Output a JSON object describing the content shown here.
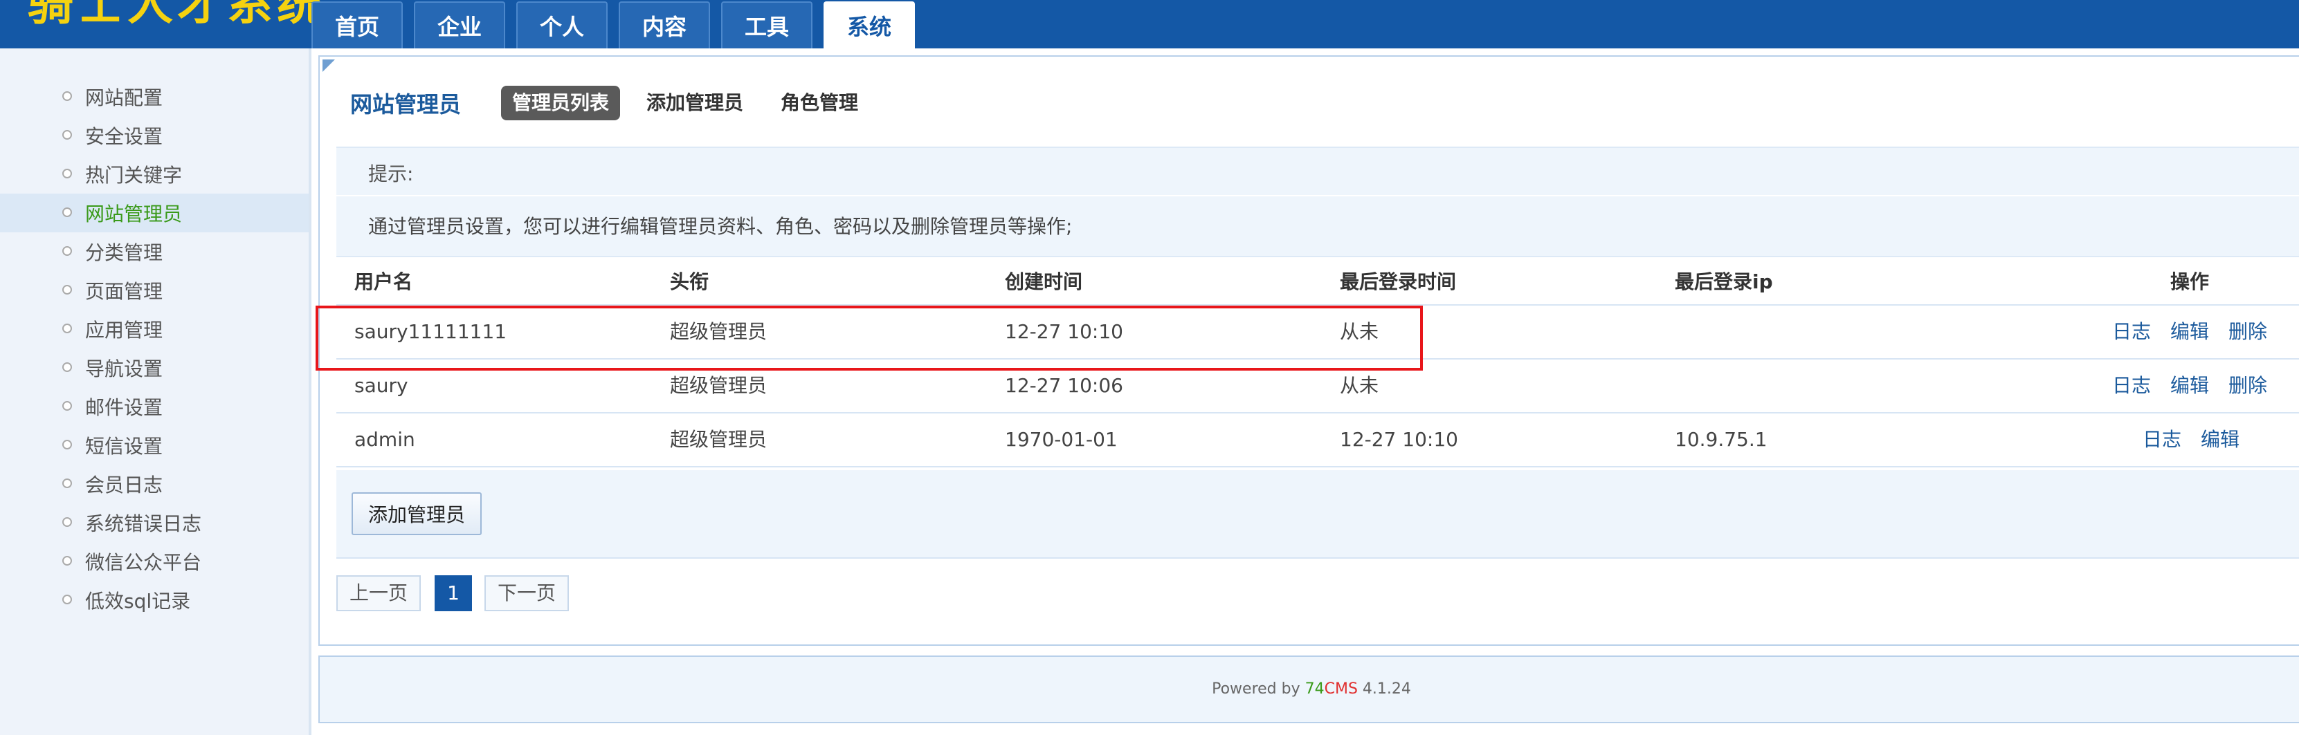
{
  "header": {
    "logo_text": "骑士人才系统",
    "nav": [
      "首页",
      "企业",
      "个人",
      "内容",
      "工具",
      "系统"
    ],
    "active_nav": "系统"
  },
  "sidebar": {
    "items": [
      {
        "label": "网站配置"
      },
      {
        "label": "安全设置"
      },
      {
        "label": "热门关键字"
      },
      {
        "label": "网站管理员",
        "active": true
      },
      {
        "label": "分类管理"
      },
      {
        "label": "页面管理"
      },
      {
        "label": "应用管理"
      },
      {
        "label": "导航设置"
      },
      {
        "label": "邮件设置"
      },
      {
        "label": "短信设置"
      },
      {
        "label": "会员日志"
      },
      {
        "label": "系统错误日志"
      },
      {
        "label": "微信公众平台"
      },
      {
        "label": "低效sql记录"
      }
    ]
  },
  "main": {
    "title": "网站管理员",
    "subtabs": [
      "管理员列表",
      "添加管理员",
      "角色管理"
    ],
    "tip_title": "提示:",
    "tip_text": "通过管理员设置，您可以进行编辑管理员资料、角色、密码以及删除管理员等操作;",
    "table": {
      "headers": [
        "用户名",
        "头衔",
        "创建时间",
        "最后登录时间",
        "最后登录ip",
        "操作"
      ],
      "rows": [
        {
          "username": "saury11111111",
          "title": "超级管理员",
          "created": "12-27 10:10",
          "last_login": "从未",
          "last_ip": "",
          "actions": [
            "日志",
            "编辑",
            "删除"
          ]
        },
        {
          "username": "saury",
          "title": "超级管理员",
          "created": "12-27 10:06",
          "last_login": "从未",
          "last_ip": "",
          "actions": [
            "日志",
            "编辑",
            "删除"
          ]
        },
        {
          "username": "admin",
          "title": "超级管理员",
          "created": "1970-01-01",
          "last_login": "12-27 10:10",
          "last_ip": "10.9.75.1",
          "actions": [
            "日志",
            "编辑"
          ]
        }
      ]
    },
    "add_button": "添加管理员",
    "pagination": {
      "prev": "上一页",
      "current": "1",
      "next": "下一页"
    }
  },
  "footer": {
    "powered_prefix": "Powered by ",
    "brand_num": "74",
    "brand_name": "CMS",
    "version": " 4.1.24"
  },
  "colors": {
    "header_bg": "#1458a6",
    "highlight": "#e8161a",
    "active_sidebar_text": "#3a9a1a",
    "link": "#1b5a9c"
  }
}
